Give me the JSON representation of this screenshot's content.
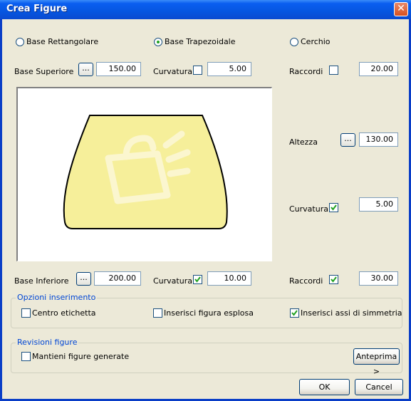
{
  "window": {
    "title": "Crea Figure"
  },
  "shape_options": [
    {
      "label": "Base Rettangolare",
      "selected": false
    },
    {
      "label": "Base Trapezoidale",
      "selected": true
    },
    {
      "label": "Cerchio",
      "selected": false
    }
  ],
  "top_row": {
    "base_superiore_label": "Base Superiore",
    "base_superiore_value": "150.00",
    "curvatura_label": "Curvatura",
    "curvatura_checked": false,
    "curvatura_value": "5.00",
    "raccordi_label": "Raccordi",
    "raccordi_checked": false,
    "raccordi_value": "20.00"
  },
  "right_column": {
    "altezza_label": "Altezza",
    "altezza_value": "130.00",
    "curvatura_label": "Curvatura",
    "curvatura_checked": true,
    "curvatura_value": "5.00"
  },
  "bottom_row": {
    "base_inferiore_label": "Base Inferiore",
    "base_inferiore_value": "200.00",
    "curvatura_label": "Curvatura",
    "curvatura_checked": true,
    "curvatura_value": "10.00",
    "raccordi_label": "Raccordi",
    "raccordi_checked": true,
    "raccordi_value": "30.00"
  },
  "dots_label": "...",
  "opzioni_inserimento": {
    "title": "Opzioni inserimento",
    "items": [
      {
        "label": "Centro etichetta",
        "checked": false
      },
      {
        "label": "Inserisci figura esplosa",
        "checked": false
      },
      {
        "label": "Inserisci assi di simmetria",
        "checked": true
      }
    ]
  },
  "revisioni_figure": {
    "title": "Revisioni figure",
    "mantieni_label": "Mantieni figure generate",
    "mantieni_checked": false,
    "anteprima_label": "Anteprima >"
  },
  "buttons": {
    "ok": "OK",
    "cancel": "Cancel"
  },
  "colors": {
    "shape_fill": "#f6ef9a",
    "titlebar": "#0a5ef0",
    "group_title": "#0046d5"
  }
}
